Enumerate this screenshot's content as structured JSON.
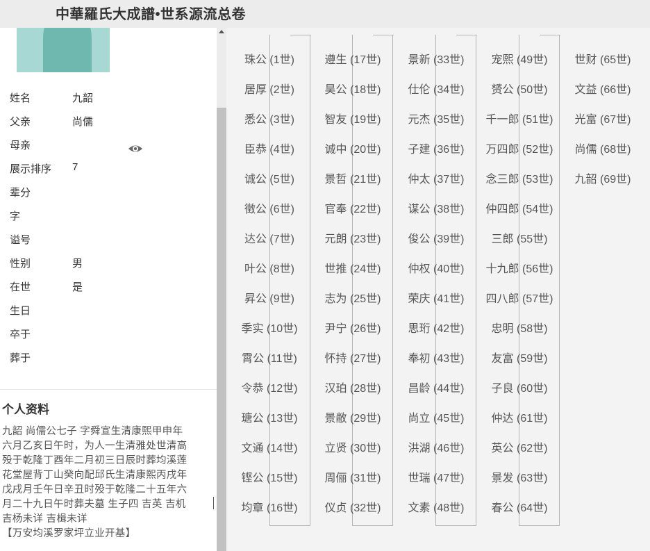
{
  "header": {
    "title": "中華羅氏大成譜•世系源流总卷"
  },
  "person": {
    "fields": [
      {
        "label": "姓名",
        "value": "九韶"
      },
      {
        "label": "父亲",
        "value": "尚儒"
      },
      {
        "label": "母亲",
        "value": ""
      },
      {
        "label": "展示排序",
        "value": "7"
      },
      {
        "label": "辈分",
        "value": ""
      },
      {
        "label": "字",
        "value": ""
      },
      {
        "label": "谥号",
        "value": ""
      },
      {
        "label": "性别",
        "value": "男"
      },
      {
        "label": "在世",
        "value": "是"
      },
      {
        "label": "生日",
        "value": ""
      },
      {
        "label": "卒于",
        "value": ""
      },
      {
        "label": "葬于",
        "value": ""
      }
    ],
    "profile_title": "个人资料",
    "bio_lines": [
      "九韶  尚儒公七子  字舜宣生清康熙甲申年",
      "六月乙亥日午时，为人一生清雅处世清高",
      "殁于乾隆丁酉年二月初三日辰时葬均溪莲",
      "花堂屋背丁山癸向配邱氏生清康熙丙戌年",
      "戊戌月壬午日辛丑时殁于乾隆二十五年六",
      "月二十九日午时葬夫墓  生子四  吉英  吉机",
      "吉杨未详  吉楫未详",
      "【万安均溪罗家坪立业开基】"
    ],
    "icons": {
      "eye": "eye-icon",
      "portrait": "portrait-image"
    }
  },
  "generations": [
    [
      "珠公 (1世)",
      "居厚 (2世)",
      "悉公 (3世)",
      "臣恭 (4世)",
      "诚公 (5世)",
      "徵公 (6世)",
      "达公 (7世)",
      "叶公 (8世)",
      "昇公 (9世)",
      "季实 (10世)",
      "霄公 (11世)",
      "令恭 (12世)",
      "瑭公 (13世)",
      "文通 (14世)",
      "铿公 (15世)",
      "均章 (16世)"
    ],
    [
      "遵生 (17世)",
      "昊公 (18世)",
      "智友 (19世)",
      "诚中 (20世)",
      "景哲 (21世)",
      "官奉 (22世)",
      "元朗 (23世)",
      "世推 (24世)",
      "志为 (25世)",
      "尹宁 (26世)",
      "怀持 (27世)",
      "汉珀 (28世)",
      "景敝 (29世)",
      "立贤 (30世)",
      "周俪 (31世)",
      "仪贞 (32世)"
    ],
    [
      "景新 (33世)",
      "仕伦 (34世)",
      "元杰 (35世)",
      "子建 (36世)",
      "仲太 (37世)",
      "谋公 (38世)",
      "俊公 (39世)",
      "仲权 (40世)",
      "荣庆 (41世)",
      "思珩 (42世)",
      "奉初 (43世)",
      "昌龄 (44世)",
      "尚立 (45世)",
      "洪湖 (46世)",
      "世瑞 (47世)",
      "文素 (48世)"
    ],
    [
      "宠熙 (49世)",
      "赟公 (50世)",
      "千一郎 (51世)",
      "万四郎 (52世)",
      "念三郎 (53世)",
      "仲四郎 (54世)",
      "三郎 (55世)",
      "十九郎 (56世)",
      "四八郎 (57世)",
      "忠明 (58世)",
      "友富 (59世)",
      "子良 (60世)",
      "仲达 (61世)",
      "英公 (62世)",
      "景发 (63世)",
      "春公 (64世)"
    ],
    [
      "世财 (65世)",
      "文益 (66世)",
      "光富 (67世)",
      "尚儒 (68世)",
      "九韶 (69世)"
    ]
  ],
  "colors": {
    "header_bg": "#ececec",
    "main_bg": "#f3f3f3",
    "connector": "#b3b3b3",
    "scroll_thumb": "#c1c1c1"
  }
}
